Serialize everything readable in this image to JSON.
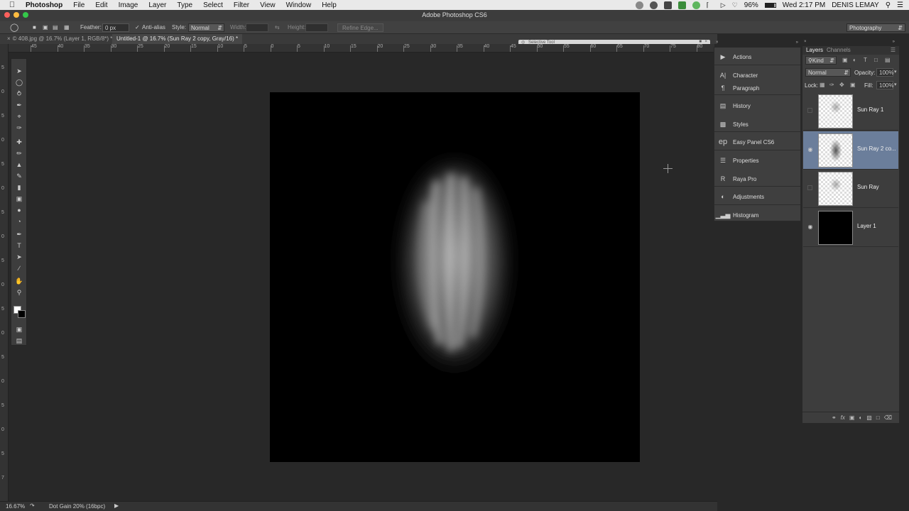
{
  "menubar": {
    "app": "Photoshop",
    "items": [
      "File",
      "Edit",
      "Image",
      "Layer",
      "Type",
      "Select",
      "Filter",
      "View",
      "Window",
      "Help"
    ],
    "battery": "96%",
    "clock": "Wed 2:17 PM",
    "user": "DENIS LEMAY"
  },
  "window": {
    "title": "Adobe Photoshop CS6"
  },
  "options": {
    "feather_label": "Feather:",
    "feather_value": "0 px",
    "antialias_label": "Anti-alias",
    "style_label": "Style:",
    "style_value": "Normal",
    "width_label": "Width:",
    "height_label": "Height:",
    "refine_edge": "Refine Edge...",
    "workspace": "Photography"
  },
  "tabs": [
    {
      "label": "© 408.jpg @ 16.7% (Layer 1, RGB/8*) *"
    },
    {
      "label": "Untitled-1 @ 16.7% (Sun Ray 2 copy, Gray/16) *"
    }
  ],
  "floating_panel": {
    "title": "Selective Tool"
  },
  "hruler_ticks": [
    "45",
    "40",
    "35",
    "30",
    "25",
    "20",
    "15",
    "10",
    "5",
    "0",
    "5",
    "10",
    "15",
    "20",
    "25",
    "30",
    "35",
    "40",
    "45",
    "50",
    "55",
    "60",
    "65",
    "70",
    "75",
    "80"
  ],
  "vruler_ticks": [
    "5",
    "0",
    "5",
    "0",
    "5",
    "0",
    "5",
    "0",
    "5",
    "0",
    "5",
    "0",
    "5",
    "0",
    "5",
    "0",
    "5",
    "7"
  ],
  "dock": {
    "items": [
      {
        "label": "Actions",
        "icon": "play-icon"
      },
      {
        "label": "Character",
        "icon": "character-icon"
      },
      {
        "label": "Paragraph",
        "icon": "paragraph-icon"
      },
      {
        "label": "History",
        "icon": "history-icon"
      },
      {
        "label": "Styles",
        "icon": "styles-icon"
      },
      {
        "label": "Easy Panel CS6",
        "icon": "ep-icon"
      },
      {
        "label": "Properties",
        "icon": "properties-icon"
      },
      {
        "label": "Raya Pro",
        "icon": "raya-icon"
      },
      {
        "label": "Adjustments",
        "icon": "adjustments-icon"
      },
      {
        "label": "Histogram",
        "icon": "histogram-icon"
      }
    ]
  },
  "layers_panel": {
    "tabs": [
      "Layers",
      "Channels"
    ],
    "kind": "Kind",
    "blend_mode": "Normal",
    "opacity_label": "Opacity:",
    "opacity_value": "100%",
    "lock_label": "Lock:",
    "fill_label": "Fill:",
    "fill_value": "100%",
    "layers": [
      {
        "name": "Sun Ray 1",
        "visible": false,
        "selected": false
      },
      {
        "name": "Sun Ray 2 co...",
        "visible": true,
        "selected": true
      },
      {
        "name": "Sun Ray",
        "visible": false,
        "selected": false
      },
      {
        "name": "Layer 1",
        "visible": true,
        "selected": false
      }
    ]
  },
  "status": {
    "zoom": "16.67%",
    "info": "Dot Gain 20% (16bpc)"
  }
}
